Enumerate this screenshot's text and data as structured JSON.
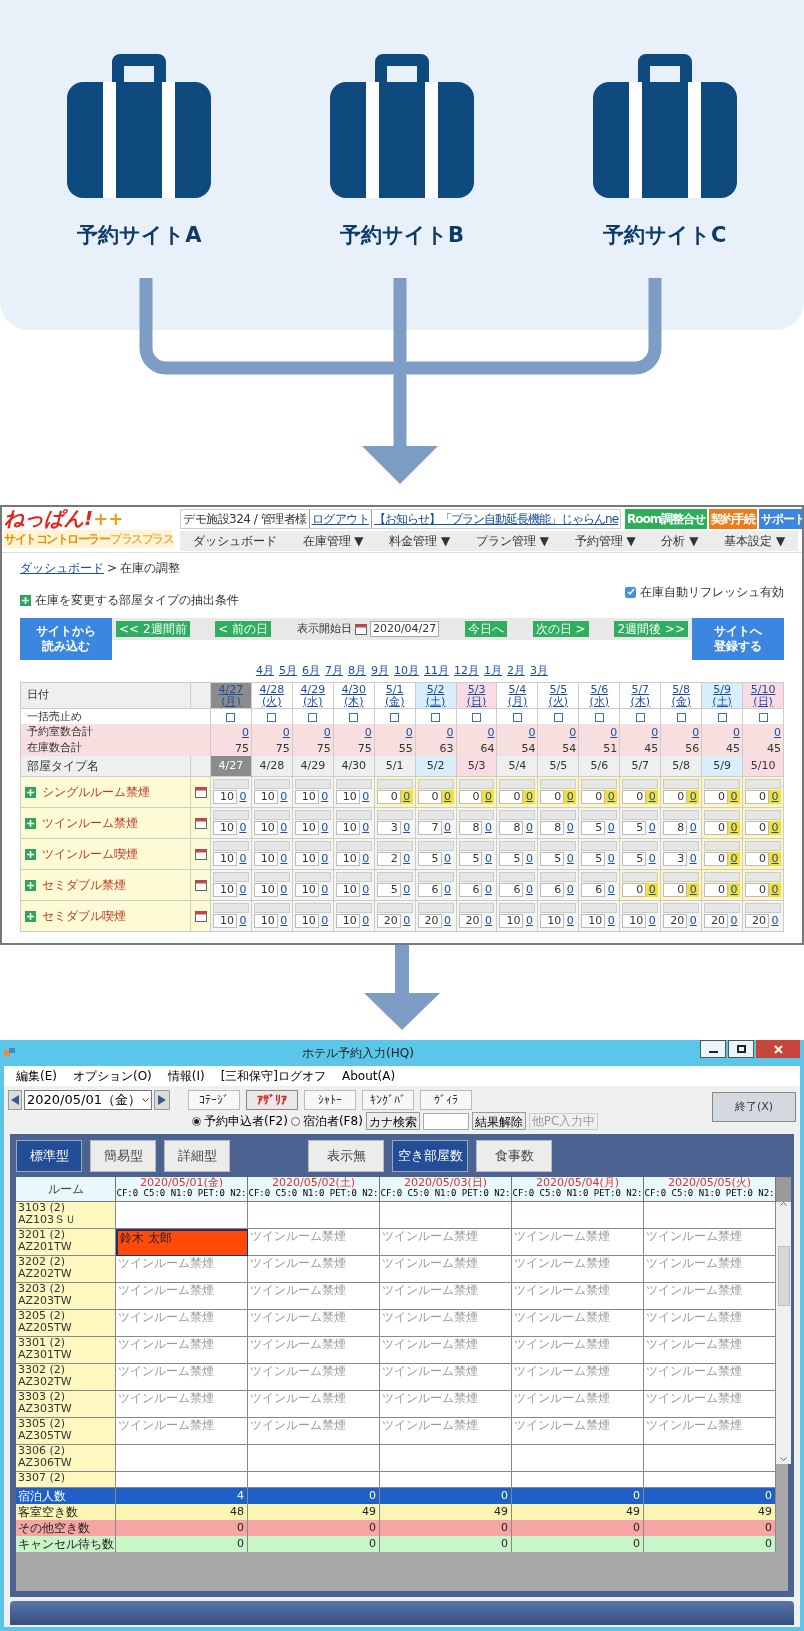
{
  "sites": [
    {
      "label": "予約サイトA"
    },
    {
      "label": "予約サイトB"
    },
    {
      "label": "予約サイトC"
    }
  ],
  "web": {
    "logo": "ねっぱん!",
    "logo_plus": "++",
    "logo_sub": "サイトコントローラー",
    "logo_sub_small": "プラスプラス",
    "account": "デモ施設324 / 管理者様",
    "logout": "ログアウト",
    "notice": "【お知らせ】「プラン自動延長機能」じゃらんne",
    "top_buttons": [
      {
        "label": "Room調整合せ",
        "color": "#2fae5a"
      },
      {
        "label": "契約手続",
        "color": "#f07a1a"
      },
      {
        "label": "サポート",
        "color": "#3a86e0"
      }
    ],
    "nav": [
      "ダッシュボード",
      "在庫管理 ▼",
      "料金管理 ▼",
      "プラン管理 ▼",
      "予約管理 ▼",
      "分析 ▼",
      "基本設定 ▼"
    ],
    "breadcrumb": {
      "link": "ダッシュボード",
      "separator": ">",
      "current": "在庫の調整"
    },
    "filter_toggle": "在庫を変更する部屋タイプの抽出条件",
    "auto_refresh": {
      "label": "在庫自動リフレッシュ有効",
      "checked": true
    },
    "load_button": [
      "サイトから",
      "読み込む"
    ],
    "register_button": [
      "サイトへ",
      "登録する"
    ],
    "nav_prev": [
      "<< 2週間前",
      "< 前の日"
    ],
    "start_label": "表示開始日",
    "start_date": "2020/04/27",
    "nav_next": [
      "今日へ",
      "次の日 >",
      "2週間後 >>"
    ],
    "months": [
      "4月",
      "5月",
      "6月",
      "7月",
      "8月",
      "9月",
      "10月",
      "11月",
      "12月",
      "1月",
      "2月",
      "3月"
    ],
    "row_labels": {
      "date": "日付",
      "stop": "一括売止め",
      "reserved": "予約室数合計",
      "stock": "在庫数合計",
      "room_type": "部屋タイプ名"
    },
    "dates": [
      {
        "date": "4/27",
        "dow": "(月)",
        "kind": "selected",
        "stop_checked": false,
        "reserved": "0",
        "stock": "75",
        "row_date": "4/27"
      },
      {
        "date": "4/28",
        "dow": "(火)",
        "kind": "weekday",
        "stop_checked": false,
        "reserved": "0",
        "stock": "75",
        "row_date": "4/28"
      },
      {
        "date": "4/29",
        "dow": "(水)",
        "kind": "weekday",
        "stop_checked": false,
        "reserved": "0",
        "stock": "75",
        "row_date": "4/29"
      },
      {
        "date": "4/30",
        "dow": "(木)",
        "kind": "weekday",
        "stop_checked": false,
        "reserved": "0",
        "stock": "75",
        "row_date": "4/30"
      },
      {
        "date": "5/1",
        "dow": "(金)",
        "kind": "weekday",
        "stop_checked": false,
        "reserved": "0",
        "stock": "55",
        "row_date": "5/1"
      },
      {
        "date": "5/2",
        "dow": "(土)",
        "kind": "saturday",
        "stop_checked": false,
        "reserved": "0",
        "stock": "63",
        "row_date": "5/2"
      },
      {
        "date": "5/3",
        "dow": "(日)",
        "kind": "sunday",
        "stop_checked": false,
        "reserved": "0",
        "stock": "64",
        "row_date": "5/3"
      },
      {
        "date": "5/4",
        "dow": "(月)",
        "kind": "weekday",
        "stop_checked": false,
        "reserved": "0",
        "stock": "54",
        "row_date": "5/4"
      },
      {
        "date": "5/5",
        "dow": "(火)",
        "kind": "weekday",
        "stop_checked": false,
        "reserved": "0",
        "stock": "54",
        "row_date": "5/5"
      },
      {
        "date": "5/6",
        "dow": "(水)",
        "kind": "weekday",
        "stop_checked": false,
        "reserved": "0",
        "stock": "51",
        "row_date": "5/6"
      },
      {
        "date": "5/7",
        "dow": "(木)",
        "kind": "weekday",
        "stop_checked": false,
        "reserved": "0",
        "stock": "45",
        "row_date": "5/7"
      },
      {
        "date": "5/8",
        "dow": "(金)",
        "kind": "weekday",
        "stop_checked": false,
        "reserved": "0",
        "stock": "56",
        "row_date": "5/8"
      },
      {
        "date": "5/9",
        "dow": "(土)",
        "kind": "saturday",
        "stop_checked": false,
        "reserved": "0",
        "stock": "45",
        "row_date": "5/9"
      },
      {
        "date": "5/10",
        "dow": "(日)",
        "kind": "sunday",
        "stop_checked": false,
        "reserved": "0",
        "stock": "45",
        "row_date": "5/10"
      }
    ],
    "room_types": [
      {
        "name": "シングルルーム禁煙",
        "cells": [
          {
            "stock": "10",
            "sold": "0",
            "full": false
          },
          {
            "stock": "10",
            "sold": "0",
            "full": false
          },
          {
            "stock": "10",
            "sold": "0",
            "full": false
          },
          {
            "stock": "10",
            "sold": "0",
            "full": false
          },
          {
            "stock": "0",
            "sold": "0",
            "full": true
          },
          {
            "stock": "0",
            "sold": "0",
            "full": true
          },
          {
            "stock": "0",
            "sold": "0",
            "full": true
          },
          {
            "stock": "0",
            "sold": "0",
            "full": true
          },
          {
            "stock": "0",
            "sold": "0",
            "full": true
          },
          {
            "stock": "0",
            "sold": "0",
            "full": true
          },
          {
            "stock": "0",
            "sold": "0",
            "full": true
          },
          {
            "stock": "0",
            "sold": "0",
            "full": true
          },
          {
            "stock": "0",
            "sold": "0",
            "full": true
          },
          {
            "stock": "0",
            "sold": "0",
            "full": true
          }
        ]
      },
      {
        "name": "ツインルーム禁煙",
        "cells": [
          {
            "stock": "10",
            "sold": "0",
            "full": false
          },
          {
            "stock": "10",
            "sold": "0",
            "full": false
          },
          {
            "stock": "10",
            "sold": "0",
            "full": false
          },
          {
            "stock": "10",
            "sold": "0",
            "full": false
          },
          {
            "stock": "3",
            "sold": "0",
            "full": false
          },
          {
            "stock": "7",
            "sold": "0",
            "full": false
          },
          {
            "stock": "8",
            "sold": "0",
            "full": false
          },
          {
            "stock": "8",
            "sold": "0",
            "full": false
          },
          {
            "stock": "8",
            "sold": "0",
            "full": false
          },
          {
            "stock": "5",
            "sold": "0",
            "full": false
          },
          {
            "stock": "5",
            "sold": "0",
            "full": false
          },
          {
            "stock": "8",
            "sold": "0",
            "full": false
          },
          {
            "stock": "0",
            "sold": "0",
            "full": true
          },
          {
            "stock": "0",
            "sold": "0",
            "full": true
          }
        ]
      },
      {
        "name": "ツインルーム喫煙",
        "cells": [
          {
            "stock": "10",
            "sold": "0",
            "full": false
          },
          {
            "stock": "10",
            "sold": "0",
            "full": false
          },
          {
            "stock": "10",
            "sold": "0",
            "full": false
          },
          {
            "stock": "10",
            "sold": "0",
            "full": false
          },
          {
            "stock": "2",
            "sold": "0",
            "full": false
          },
          {
            "stock": "5",
            "sold": "0",
            "full": false
          },
          {
            "stock": "5",
            "sold": "0",
            "full": false
          },
          {
            "stock": "5",
            "sold": "0",
            "full": false
          },
          {
            "stock": "5",
            "sold": "0",
            "full": false
          },
          {
            "stock": "5",
            "sold": "0",
            "full": false
          },
          {
            "stock": "5",
            "sold": "0",
            "full": false
          },
          {
            "stock": "3",
            "sold": "0",
            "full": false
          },
          {
            "stock": "0",
            "sold": "0",
            "full": true
          },
          {
            "stock": "0",
            "sold": "0",
            "full": true
          }
        ]
      },
      {
        "name": "セミダブル禁煙",
        "cells": [
          {
            "stock": "10",
            "sold": "0",
            "full": false
          },
          {
            "stock": "10",
            "sold": "0",
            "full": false
          },
          {
            "stock": "10",
            "sold": "0",
            "full": false
          },
          {
            "stock": "10",
            "sold": "0",
            "full": false
          },
          {
            "stock": "5",
            "sold": "0",
            "full": false
          },
          {
            "stock": "6",
            "sold": "0",
            "full": false
          },
          {
            "stock": "6",
            "sold": "0",
            "full": false
          },
          {
            "stock": "6",
            "sold": "0",
            "full": false
          },
          {
            "stock": "6",
            "sold": "0",
            "full": false
          },
          {
            "stock": "6",
            "sold": "0",
            "full": false
          },
          {
            "stock": "0",
            "sold": "0",
            "full": true
          },
          {
            "stock": "0",
            "sold": "0",
            "full": true
          },
          {
            "stock": "0",
            "sold": "0",
            "full": true
          },
          {
            "stock": "0",
            "sold": "0",
            "full": true
          }
        ]
      },
      {
        "name": "セミダブル喫煙",
        "cells": [
          {
            "stock": "10",
            "sold": "0",
            "full": false
          },
          {
            "stock": "10",
            "sold": "0",
            "full": false
          },
          {
            "stock": "10",
            "sold": "0",
            "full": false
          },
          {
            "stock": "10",
            "sold": "0",
            "full": false
          },
          {
            "stock": "20",
            "sold": "0",
            "full": false
          },
          {
            "stock": "20",
            "sold": "0",
            "full": false
          },
          {
            "stock": "20",
            "sold": "0",
            "full": false
          },
          {
            "stock": "10",
            "sold": "0",
            "full": false
          },
          {
            "stock": "10",
            "sold": "0",
            "full": false
          },
          {
            "stock": "10",
            "sold": "0",
            "full": false
          },
          {
            "stock": "10",
            "sold": "0",
            "full": false
          },
          {
            "stock": "20",
            "sold": "0",
            "full": false
          },
          {
            "stock": "20",
            "sold": "0",
            "full": false
          },
          {
            "stock": "20",
            "sold": "0",
            "full": false
          }
        ]
      }
    ]
  },
  "app": {
    "title": "ホテル予約入力(HQ)",
    "menu": [
      "編集(E)",
      "オプション(O)",
      "情報(I)",
      "[三和保守]ログオフ",
      "About(A)"
    ],
    "date": "2020/05/01（金）",
    "buildings": [
      {
        "label": "ｺﾃｰｼﾞ",
        "selected": false
      },
      {
        "label": "ｱｻﾞﾘｱ",
        "selected": true
      },
      {
        "label": "ｼｬﾄｰ",
        "selected": false
      },
      {
        "label": "ｷﾝｸﾞﾊﾞ",
        "selected": false
      },
      {
        "label": "ｳﾞｨﾗ",
        "selected": false
      }
    ],
    "radios": [
      {
        "label": "予約申込者(F2)",
        "selected": true
      },
      {
        "label": "宿泊者(F8)",
        "selected": false
      }
    ],
    "kana_search": "カナ検索",
    "clear_results": "結果解除",
    "other_pc": "他PC入力中",
    "exit": "終了(X)",
    "view_types": [
      {
        "label": "標準型",
        "selected": true
      },
      {
        "label": "簡易型",
        "selected": false
      },
      {
        "label": "詳細型",
        "selected": false
      }
    ],
    "display_modes": [
      {
        "label": "表示無",
        "selected": false
      },
      {
        "label": "空き部屋数",
        "selected": true
      },
      {
        "label": "食事数",
        "selected": false
      }
    ],
    "room_header": "ルーム",
    "columns": [
      {
        "date": "2020/05/01(金)",
        "counts": "CF:0 C5:0 N1:0 PET:0 N2:"
      },
      {
        "date": "2020/05/02(土)",
        "counts": "CF:0 C5:0 N1:0 PET:0 N2:"
      },
      {
        "date": "2020/05/03(日)",
        "counts": "CF:0 C5:0 N1:0 PET:0 N2:"
      },
      {
        "date": "2020/05/04(月)",
        "counts": "CF:0 C5:0 N1:0 PET:0 N2:"
      },
      {
        "date": "2020/05/05(火)",
        "counts": "CF:0 C5:0 N1:0 PET:0 N2:"
      }
    ],
    "rooms": [
      {
        "room": "3103 (2)",
        "code": "AZ103ＳＵ",
        "cells": [
          null,
          null,
          null,
          null,
          null
        ]
      },
      {
        "room": "3201 (2)",
        "code": "AZ201TW",
        "cells": [
          {
            "text": "鈴木 太郎",
            "booked": true
          },
          {
            "text": "ツインルーム禁煙",
            "booked": false
          },
          {
            "text": "ツインルーム禁煙",
            "booked": false
          },
          {
            "text": "ツインルーム禁煙",
            "booked": false
          },
          {
            "text": "ツインルーム禁煙",
            "booked": false
          }
        ]
      },
      {
        "room": "3202 (2)",
        "code": "AZ202TW",
        "cells": [
          {
            "text": "ツインルーム禁煙",
            "booked": false
          },
          {
            "text": "ツインルーム禁煙",
            "booked": false
          },
          {
            "text": "ツインルーム禁煙",
            "booked": false
          },
          {
            "text": "ツインルーム禁煙",
            "booked": false
          },
          {
            "text": "ツインルーム禁煙",
            "booked": false
          }
        ]
      },
      {
        "room": "3203 (2)",
        "code": "AZ203TW",
        "cells": [
          {
            "text": "ツインルーム禁煙",
            "booked": false
          },
          {
            "text": "ツインルーム禁煙",
            "booked": false
          },
          {
            "text": "ツインルーム禁煙",
            "booked": false
          },
          {
            "text": "ツインルーム禁煙",
            "booked": false
          },
          {
            "text": "ツインルーム禁煙",
            "booked": false
          }
        ]
      },
      {
        "room": "3205 (2)",
        "code": "AZ205TW",
        "cells": [
          {
            "text": "ツインルーム禁煙",
            "booked": false
          },
          {
            "text": "ツインルーム禁煙",
            "booked": false
          },
          {
            "text": "ツインルーム禁煙",
            "booked": false
          },
          {
            "text": "ツインルーム禁煙",
            "booked": false
          },
          {
            "text": "ツインルーム禁煙",
            "booked": false
          }
        ]
      },
      {
        "room": "3301 (2)",
        "code": "AZ301TW",
        "cells": [
          {
            "text": "ツインルーム禁煙",
            "booked": false
          },
          {
            "text": "ツインルーム禁煙",
            "booked": false
          },
          {
            "text": "ツインルーム禁煙",
            "booked": false
          },
          {
            "text": "ツインルーム禁煙",
            "booked": false
          },
          {
            "text": "ツインルーム禁煙",
            "booked": false
          }
        ]
      },
      {
        "room": "3302 (2)",
        "code": "AZ302TW",
        "cells": [
          {
            "text": "ツインルーム禁煙",
            "booked": false
          },
          {
            "text": "ツインルーム禁煙",
            "booked": false
          },
          {
            "text": "ツインルーム禁煙",
            "booked": false
          },
          {
            "text": "ツインルーム禁煙",
            "booked": false
          },
          {
            "text": "ツインルーム禁煙",
            "booked": false
          }
        ]
      },
      {
        "room": "3303 (2)",
        "code": "AZ303TW",
        "cells": [
          {
            "text": "ツインルーム禁煙",
            "booked": false
          },
          {
            "text": "ツインルーム禁煙",
            "booked": false
          },
          {
            "text": "ツインルーム禁煙",
            "booked": false
          },
          {
            "text": "ツインルーム禁煙",
            "booked": false
          },
          {
            "text": "ツインルーム禁煙",
            "booked": false
          }
        ]
      },
      {
        "room": "3305 (2)",
        "code": "AZ305TW",
        "cells": [
          {
            "text": "ツインルーム禁煙",
            "booked": false
          },
          {
            "text": "ツインルーム禁煙",
            "booked": false
          },
          {
            "text": "ツインルーム禁煙",
            "booked": false
          },
          {
            "text": "ツインルーム禁煙",
            "booked": false
          },
          {
            "text": "ツインルーム禁煙",
            "booked": false
          }
        ]
      },
      {
        "room": "3306 (2)",
        "code": "AZ306TW",
        "cells": [
          null,
          null,
          null,
          null,
          null
        ]
      },
      {
        "room": "3307 (2)",
        "cells": [
          null,
          null,
          null,
          null,
          null
        ]
      }
    ],
    "summary": [
      {
        "label": "宿泊人数",
        "color": "#1f5fc8",
        "values": [
          "4",
          "0",
          "0",
          "0",
          "0"
        ]
      },
      {
        "label": "客室空き数",
        "color": "#fbf5b4",
        "values": [
          "48",
          "49",
          "49",
          "49",
          "49"
        ]
      },
      {
        "label": "その他空き数",
        "color": "#f5a5a3",
        "values": [
          "0",
          "0",
          "0",
          "0",
          "0"
        ]
      },
      {
        "label": "キャンセル待ち数",
        "color": "#c9f6c9",
        "values": [
          "0",
          "0",
          "0",
          "0",
          "0"
        ]
      }
    ]
  }
}
